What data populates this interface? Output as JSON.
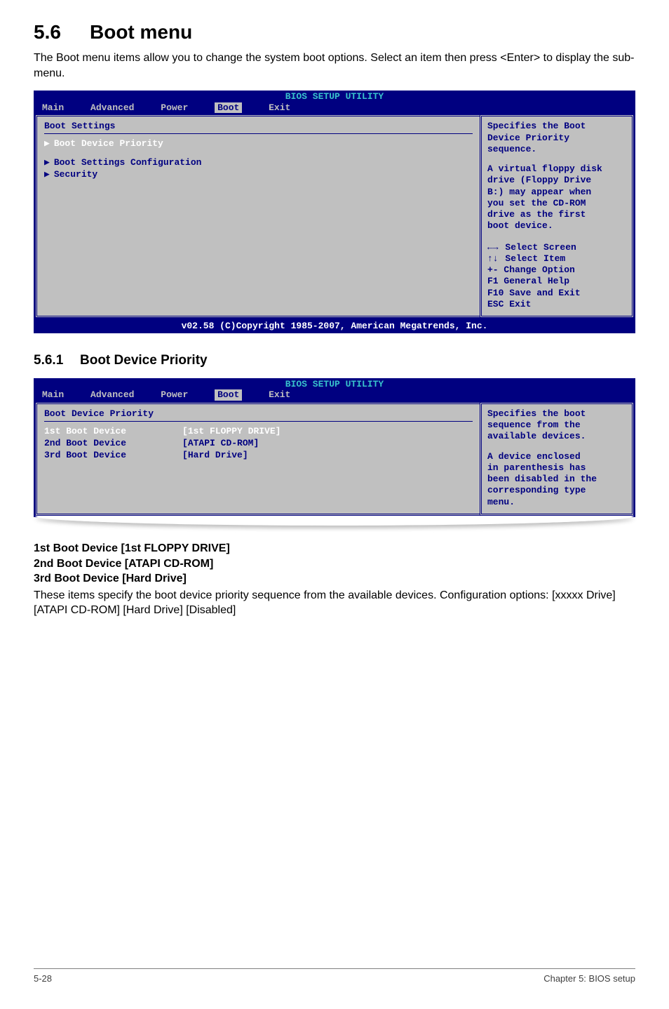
{
  "section": {
    "number": "5.6",
    "title": "Boot menu",
    "intro": "The Boot menu items allow you to change the system boot options. Select an item then press <Enter> to display the sub-menu."
  },
  "bios1": {
    "title": "BIOS SETUP UTILITY",
    "tabs": {
      "main": "Main",
      "advanced": "Advanced",
      "power": "Power",
      "boot": "Boot",
      "exit": "Exit"
    },
    "header": "Boot Settings",
    "item_priority": "Boot Device Priority",
    "item_config": "Boot Settings Configuration",
    "item_security": "Security",
    "help": {
      "l1": "Specifies the Boot",
      "l2": "Device Priority",
      "l3": "sequence.",
      "l4": "A virtual floppy disk",
      "l5": "drive (Floppy Drive",
      "l6": "B:) may appear when",
      "l7": "you set the CD-ROM",
      "l8": "drive as the first",
      "l9": "boot device.",
      "nav1": "Select Screen",
      "nav2": "Select Item",
      "nav3": "+-  Change Option",
      "nav4": "F1  General Help",
      "nav5": "F10 Save and Exit",
      "nav6": "ESC Exit"
    },
    "footer": "v02.58 (C)Copyright 1985-2007, American Megatrends, Inc."
  },
  "subsection": {
    "number": "5.6.1",
    "title": "Boot Device Priority"
  },
  "bios2": {
    "title": "BIOS SETUP UTILITY",
    "tabs": {
      "main": "Main",
      "advanced": "Advanced",
      "power": "Power",
      "boot": "Boot",
      "exit": "Exit"
    },
    "header": "Boot Device Priority",
    "row1": {
      "label": "1st Boot Device",
      "value": "[1st FLOPPY DRIVE]"
    },
    "row2": {
      "label": "2nd Boot Device",
      "value": "[ATAPI CD-ROM]"
    },
    "row3": {
      "label": "3rd Boot Device",
      "value": "[Hard Drive]"
    },
    "help": {
      "l1": "Specifies the boot",
      "l2": "sequence from the",
      "l3": "available devices.",
      "l4": "A device enclosed",
      "l5": "in parenthesis has",
      "l6": "been disabled in the",
      "l7": "corresponding type",
      "l8": "menu."
    }
  },
  "items": {
    "h1": "1st Boot Device [1st FLOPPY DRIVE]",
    "h2": "2nd Boot Device [ATAPI CD-ROM]",
    "h3": "3rd Boot Device [Hard Drive]",
    "p1": "These items specify the boot device priority sequence from the available devices. Configuration options: [xxxxx Drive] [ATAPI CD-ROM] [Hard Drive] [Disabled]"
  },
  "footer": {
    "left": "5-28",
    "right": "Chapter 5: BIOS setup"
  }
}
